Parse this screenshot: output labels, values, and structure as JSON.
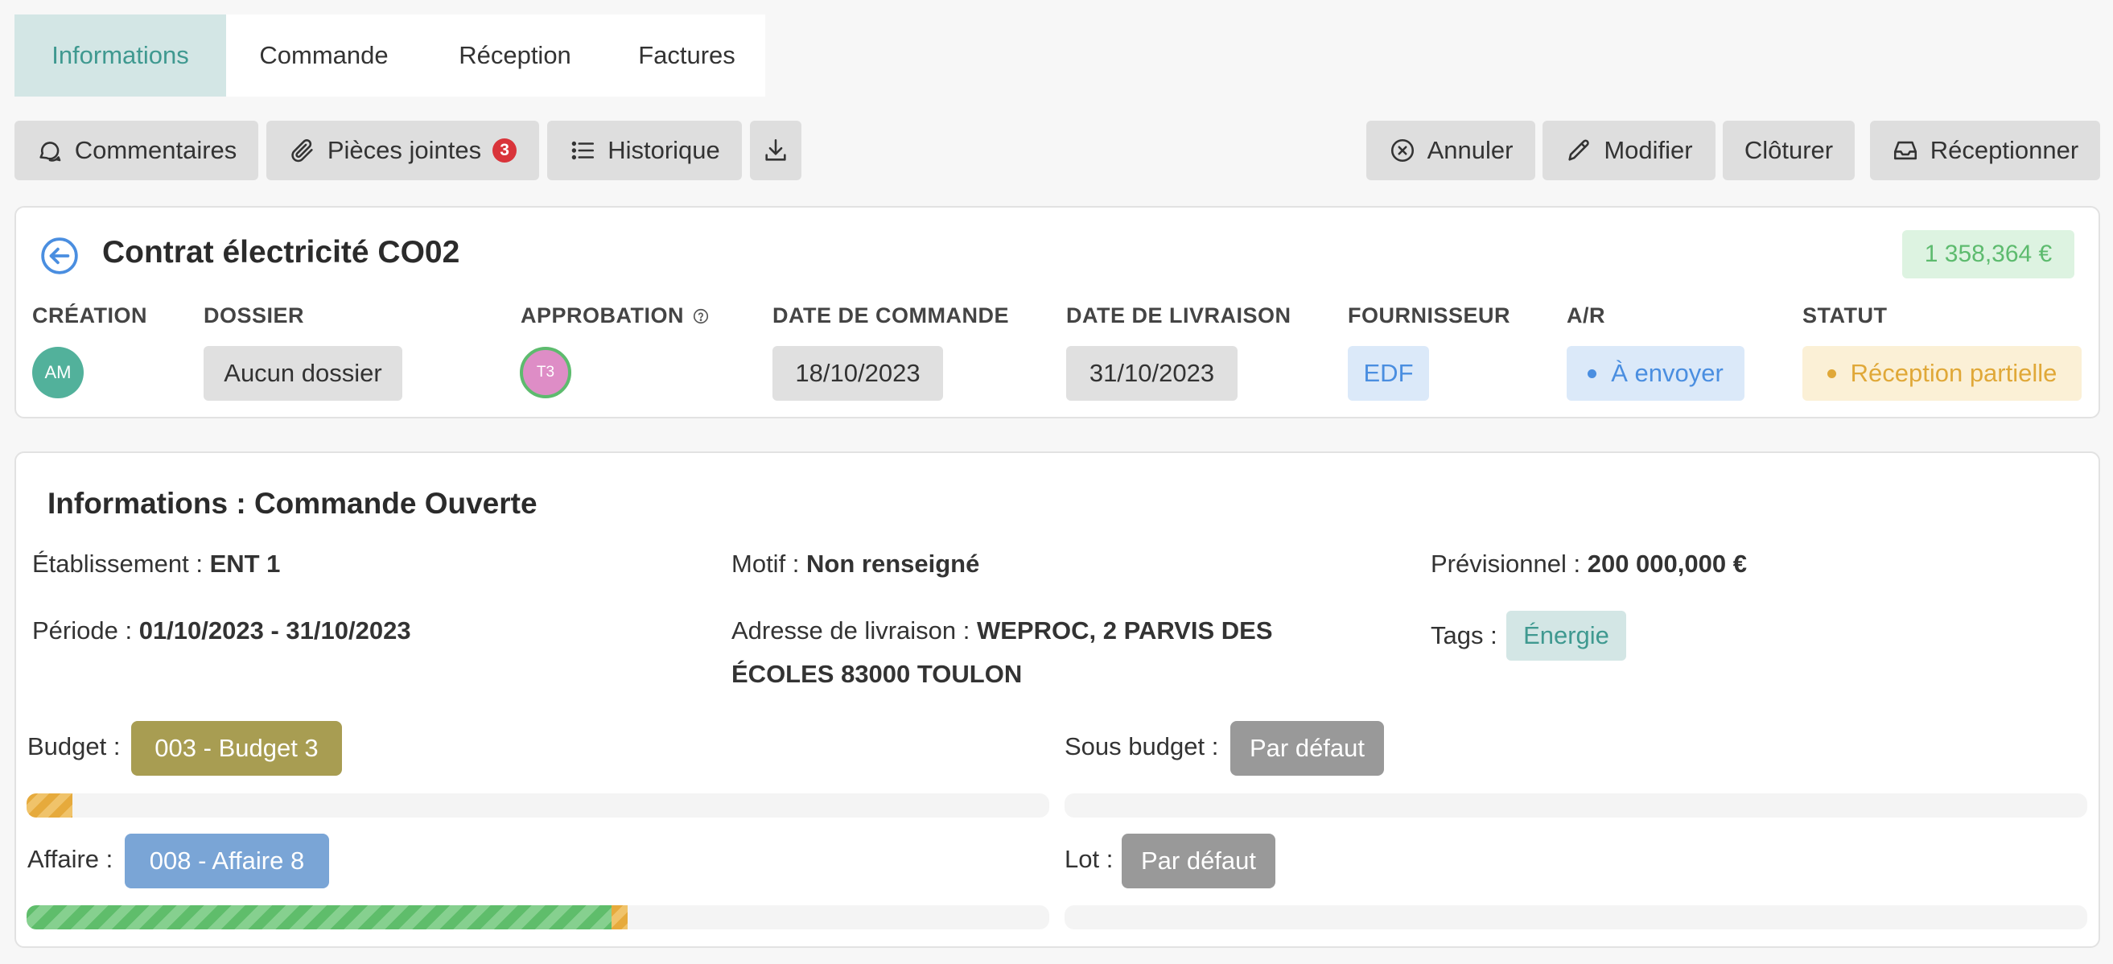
{
  "tabs": [
    {
      "label": "Informations",
      "active": true
    },
    {
      "label": "Commande",
      "active": false
    },
    {
      "label": "Réception",
      "active": false
    },
    {
      "label": "Factures",
      "active": false
    }
  ],
  "toolbar": {
    "comments_label": "Commentaires",
    "attachments_label": "Pièces jointes",
    "attachments_count": "3",
    "history_label": "Historique",
    "cancel_label": "Annuler",
    "edit_label": "Modifier",
    "close_label": "Clôturer",
    "receive_label": "Réceptionner"
  },
  "order": {
    "title": "Contrat électricité CO02",
    "amount": "1 358,364 €",
    "fields": {
      "creation_label": "CRÉATION",
      "creation_avatar": "AM",
      "dossier_label": "DOSSIER",
      "dossier_value": "Aucun dossier",
      "approval_label": "APPROBATION",
      "approval_avatar": "T3",
      "order_date_label": "DATE DE COMMANDE",
      "order_date": "18/10/2023",
      "delivery_date_label": "DATE DE LIVRAISON",
      "delivery_date": "31/10/2023",
      "supplier_label": "FOURNISSEUR",
      "supplier": "EDF",
      "ar_label": "A/R",
      "ar_value": "À envoyer",
      "status_label": "STATUT",
      "status_value": "Réception partielle"
    }
  },
  "details": {
    "section_title": "Informations : Commande Ouverte",
    "establishment_label": "Établissement :",
    "establishment_value": "ENT 1",
    "reason_label": "Motif :",
    "reason_value": "Non renseigné",
    "forecast_label": "Prévisionnel :",
    "forecast_value": "200 000,000 €",
    "period_label": "Période :",
    "period_value": "01/10/2023 - 31/10/2023",
    "address_label": "Adresse de livraison :",
    "address_line1": "WEPROC, 2 PARVIS DES",
    "address_line2": "ÉCOLES 83000 TOULON",
    "tags_label": "Tags :",
    "tag": "Énergie",
    "budget_label": "Budget :",
    "budget_value": "003 - Budget 3",
    "sub_budget_label": "Sous budget :",
    "sub_budget_value": "Par défaut",
    "affaire_label": "Affaire :",
    "affaire_value": "008 - Affaire 8",
    "lot_label": "Lot :",
    "lot_value": "Par défaut"
  },
  "progress": {
    "budget_used_fraction": 0.045,
    "affaire_green_fraction": 0.572,
    "affaire_yellow_fraction": 0.016,
    "sub_budget_fraction": 0,
    "lot_fraction": 0
  },
  "colors": {
    "accent_teal": "#3f9990",
    "budget_pill": "#a89d52",
    "affaire_pill": "#7aa5d6",
    "default_pill": "#999999",
    "progress_green": "#5fbd6b",
    "progress_yellow": "#e6aa3c"
  }
}
